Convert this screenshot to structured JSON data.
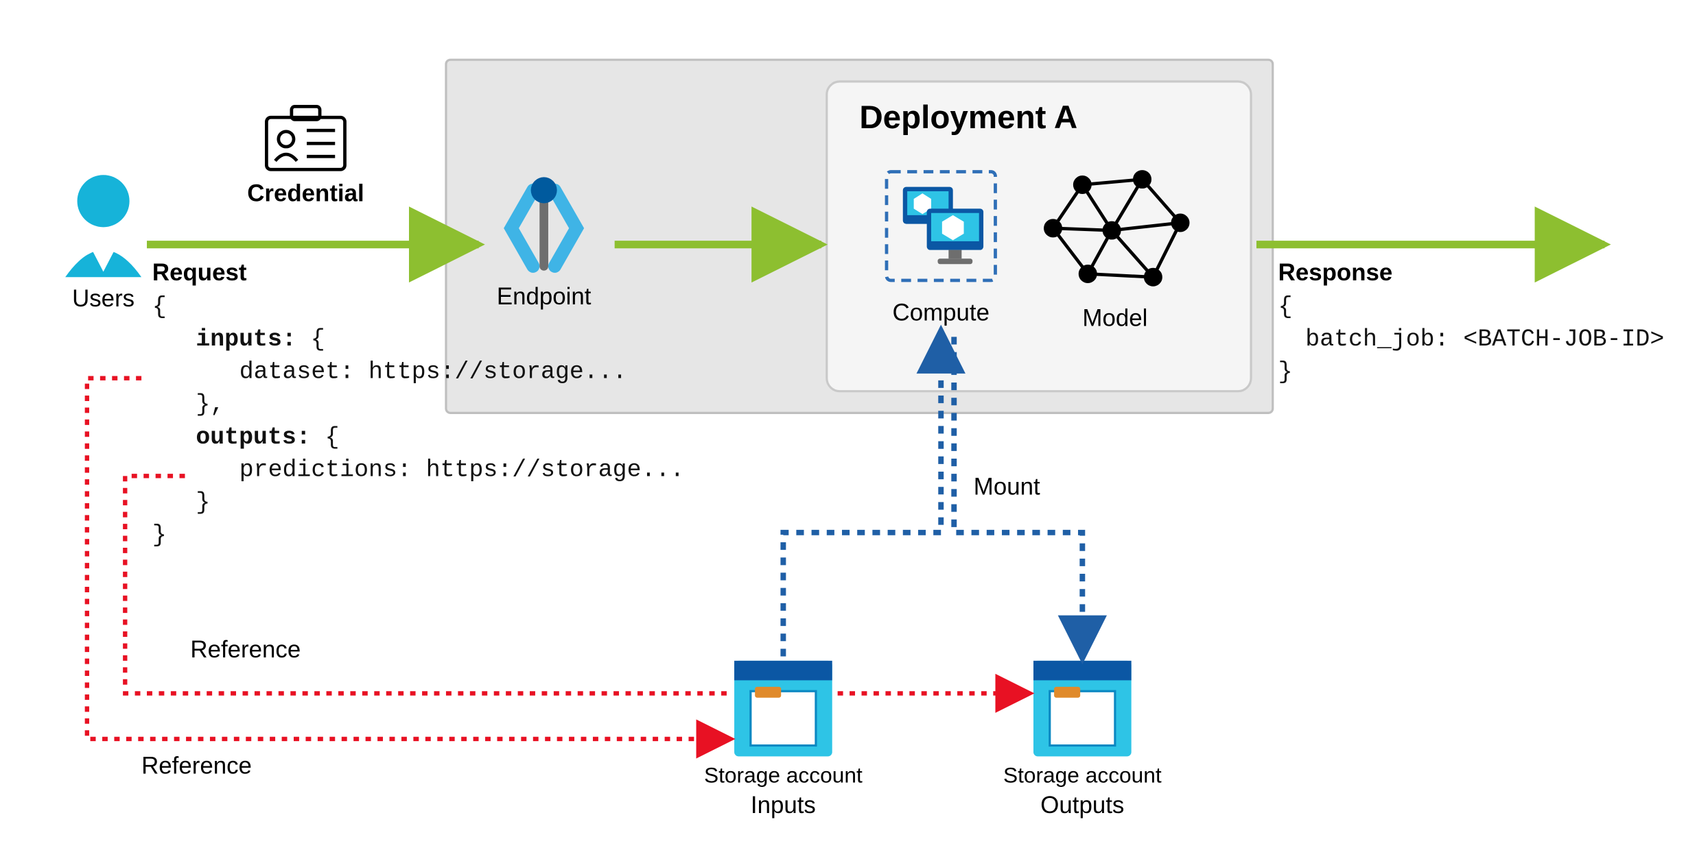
{
  "colors": {
    "flowGreen": "#8DBF30",
    "endpointBlue": "#3FB4E6",
    "endpointDark": "#005A9E",
    "computeDash": "#2F6FB7",
    "deployBg": "#F5F5F5",
    "deployBorder": "#C9C9C9",
    "outerBg": "#E6E6E6",
    "outerBorder": "#BFBFBF",
    "storageTop": "#0B57A4",
    "storageBody": "#2EC4E6",
    "mountBlue": "#1F5FA6",
    "refRed": "#E81123"
  },
  "nodes": {
    "users": "Users",
    "credential": "Credential",
    "endpoint": "Endpoint",
    "compute": "Compute",
    "model": "Model",
    "deployment": "Deployment A",
    "storage_account": "Storage account",
    "inputs": "Inputs",
    "outputs": "Outputs"
  },
  "edges": {
    "mount": "Mount",
    "reference": "Reference"
  },
  "labels": {
    "request": "Request",
    "response": "Response"
  },
  "request_lines": {
    "l1": "{",
    "l2": "inputs:",
    "l2b": " {",
    "l3": "dataset: https://storage...",
    "l4": "},",
    "l5": "outputs:",
    "l5b": " {",
    "l6": "predictions: https://storage...",
    "l7": "}",
    "l8": "}"
  },
  "response_lines": {
    "l1": "{",
    "l2": "batch_job: <BATCH-JOB-ID>",
    "l3": "}"
  }
}
